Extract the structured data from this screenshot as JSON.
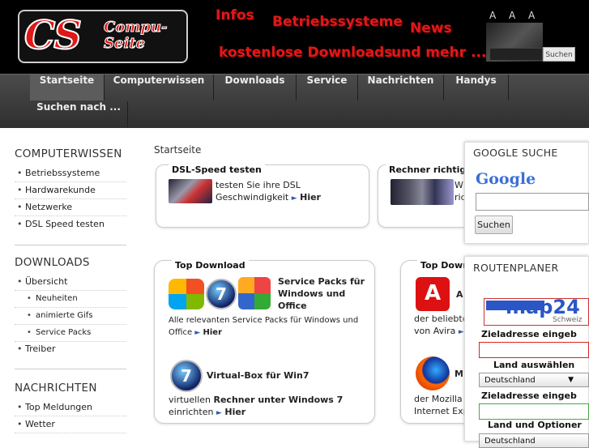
{
  "header": {
    "logo_main": "CS",
    "logo_sub": "Compu-Seite",
    "promo": [
      "Infos",
      "Betriebssysteme",
      "News",
      "kostenlose Downloads",
      "und mehr ..."
    ],
    "font_size_controls": "A A A",
    "search_button": "Suchen"
  },
  "nav": {
    "items": [
      "Startseite",
      "Computerwissen",
      "Downloads",
      "Service",
      "Nachrichten",
      "Handys"
    ],
    "second_row": "Suchen nach ...",
    "active": "Startseite"
  },
  "sidebar": {
    "sections": [
      {
        "title": "COMPUTERWISSEN",
        "items": [
          "Betriebssysteme",
          "Hardwarekunde",
          "Netzwerke",
          "DSL Speed testen"
        ]
      },
      {
        "title": "DOWNLOADS",
        "items": [
          "Übersicht",
          "Neuheiten",
          "animierte Gifs",
          "Service Packs",
          "Treiber"
        ]
      },
      {
        "title": "NACHRICHTEN",
        "items": [
          "Top Meldungen",
          "Wetter"
        ]
      }
    ]
  },
  "main": {
    "breadcrumb": "Startseite",
    "dsl_box": {
      "title": "DSL-Speed testen",
      "text1": "testen Sie ihre DSL",
      "text2": "Geschwindigkeit",
      "link": "Hier"
    },
    "rechner_box": {
      "title": "Rechner richtig",
      "text1": "W",
      "text2": "ric"
    },
    "top_download_1": {
      "title": "Top Download",
      "sp_title": "Service Packs für Windows und Office",
      "sp_text": "Alle relevanten Service Packs für Windows und Office",
      "sp_link": "Hier",
      "vb_title": "Virtual-Box für Win7",
      "vb_text1": "virtuellen",
      "vb_text1b": "Rechner unter Windows 7",
      "vb_text2": "einrichten",
      "vb_link": "Hier"
    },
    "top_download_2": {
      "title": "Top Down",
      "av_title": "A",
      "av_text1": "der beliebte",
      "av_text2": "von Avira",
      "ff_title": "M",
      "ff_text1": "der Mozilla F",
      "ff_text2": "Internet Exp"
    }
  },
  "right": {
    "google": {
      "title": "GOOGLE SUCHE",
      "logo": "Google",
      "button": "Suchen"
    },
    "routen": {
      "title": "ROUTENPLANER",
      "logo": "map24",
      "logo_sub": "Schweiz",
      "ziel1": "Zieladresse eingeb",
      "land1": "Land auswählen",
      "country1": "Deutschland",
      "ziel2": "Zieladresse eingeb",
      "land2": "Land und Optioner",
      "country2": "Deutschland"
    }
  },
  "colors": {
    "brand_red": "#e01818",
    "nav_bg": "#3a3a3a",
    "header_bg": "#000000",
    "link_arrow": "#2a5ab8"
  }
}
